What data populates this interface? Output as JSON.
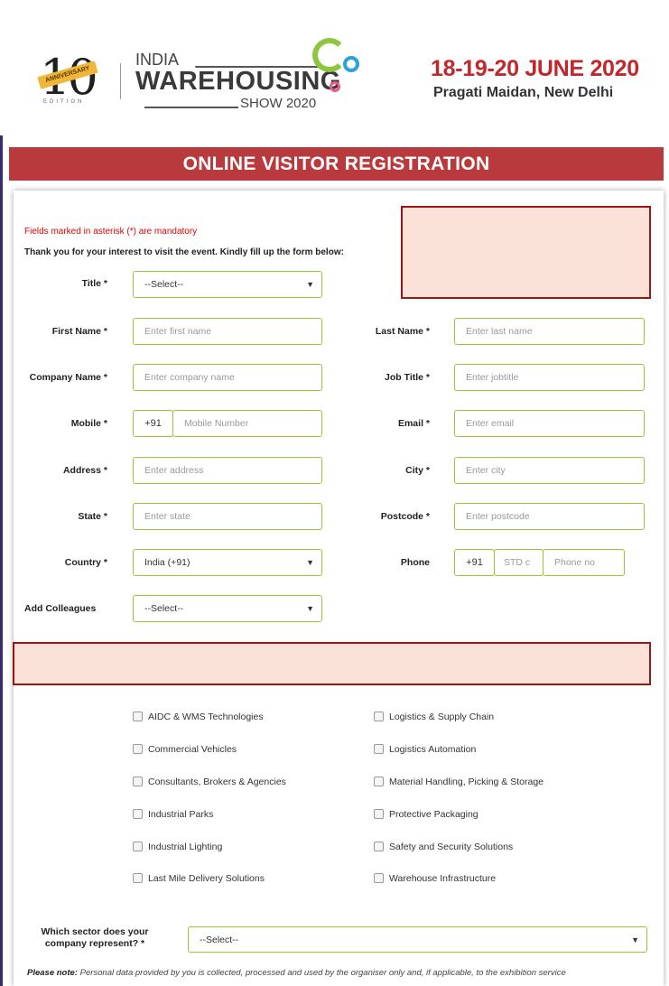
{
  "header": {
    "logo_10": "10",
    "logo_ribbon": "ANNIVERSARY",
    "logo_edition": "EDITION",
    "brand_line1": "INDIA",
    "brand_line2": "WAREHOUSING",
    "brand_line3": "SHOW 2020",
    "dates": "18-19-20 JUNE 2020",
    "venue": "Pragati Maidan, New Delhi"
  },
  "banner": {
    "title": "ONLINE VISITOR REGISTRATION"
  },
  "form": {
    "mandatory_note": "Fields marked in asterisk (*) are mandatory",
    "intro": "Thank you for your interest to visit the event. Kindly fill up the form below:",
    "title": {
      "label": "Title *",
      "value": "--Select--"
    },
    "first_name": {
      "label": "First Name *",
      "placeholder": "Enter first name"
    },
    "last_name": {
      "label": "Last Name *",
      "placeholder": "Enter last name"
    },
    "company": {
      "label": "Company Name *",
      "placeholder": "Enter company name"
    },
    "job_title": {
      "label": "Job Title *",
      "placeholder": "Enter jobtitle"
    },
    "mobile": {
      "label": "Mobile *",
      "prefix": "+91",
      "placeholder": "Mobile Number"
    },
    "email": {
      "label": "Email *",
      "placeholder": "Enter email"
    },
    "address": {
      "label": "Address *",
      "placeholder": "Enter address"
    },
    "city": {
      "label": "City *",
      "placeholder": "Enter city"
    },
    "state": {
      "label": "State *",
      "placeholder": "Enter state"
    },
    "postcode": {
      "label": "Postcode *",
      "placeholder": "Enter postcode"
    },
    "country": {
      "label": "Country *",
      "value": "India (+91)"
    },
    "phone": {
      "label": "Phone",
      "prefix": "+91",
      "std_placeholder": "STD c",
      "no_placeholder": "Phone no"
    },
    "colleagues": {
      "label": "Add Colleagues",
      "value": "--Select--"
    }
  },
  "interests": {
    "left": [
      "AIDC & WMS Technologies",
      "Commercial Vehicles",
      "Consultants, Brokers & Agencies",
      "Industrial Parks",
      "Industrial Lighting",
      "Last Mile Delivery Solutions"
    ],
    "right": [
      "Logistics & Supply Chain",
      "Logistics Automation",
      "Material Handling, Picking & Storage",
      "Protective Packaging",
      "Safety and Security Solutions",
      "Warehouse Infrastructure"
    ]
  },
  "sector": {
    "label_line1": "Which sector does your",
    "label_line2": "company represent? *",
    "value": "--Select--"
  },
  "note": {
    "bold": "Please note:",
    "text": "Personal data provided by you is collected, processed and used by the organiser only and, if applicable, to the exhibition service"
  },
  "icons": {
    "caret": "chevron-down-icon"
  },
  "colors": {
    "accent_red": "#c0282c",
    "banner": "#b93a3c",
    "field_border": "#9ac43a"
  }
}
